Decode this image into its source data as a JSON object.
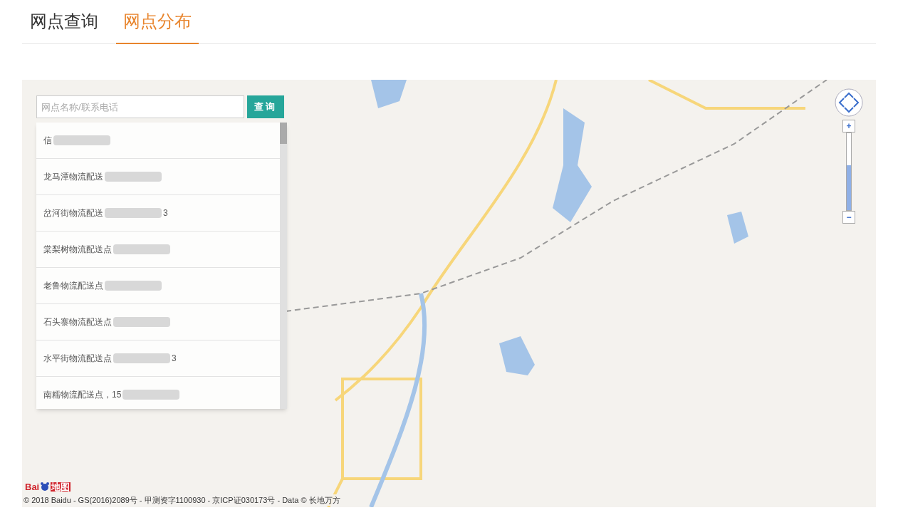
{
  "tabs": [
    {
      "label": "网点查询",
      "selected": false
    },
    {
      "label": "网点分布",
      "selected": true
    }
  ],
  "search": {
    "placeholder": "网点名称/联系电话",
    "button": "查询"
  },
  "results": [
    {
      "name": "信"
    },
    {
      "name": "龙马潭物流配送"
    },
    {
      "name": "岔河街物流配送",
      "suffix": "3"
    },
    {
      "name": "棠梨树物流配送点"
    },
    {
      "name": "老鲁物流配送点"
    },
    {
      "name": "石头寨物流配送点"
    },
    {
      "name": "水平街物流配送点",
      "suffix": "3"
    },
    {
      "name": "南糯物流配送点，15"
    }
  ],
  "zoom": {
    "level": 0.58,
    "in_label": "+",
    "out_label": "−"
  },
  "logo": {
    "latin": "Bai",
    "chinese": "地图"
  },
  "copyright": "© 2018 Baidu - GS(2016)2089号 - 甲测资字1100930 - 京ICP证030173号 - Data © 长地万方"
}
